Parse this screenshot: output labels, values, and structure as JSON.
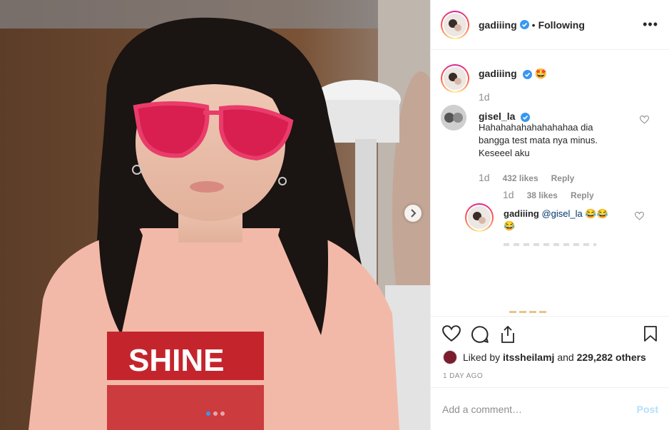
{
  "post": {
    "author": "gadiiing",
    "follow_sep": "•",
    "follow_status": "Following",
    "more_label": "•••",
    "caption_emoji": "🤩",
    "caption_time": "1d"
  },
  "comments": [
    {
      "user": "gisel_la",
      "text": "Hahahahahahahahahaa dia bangga test mata nya minus. Keseeel aku",
      "time": "1d",
      "likes": "432 likes",
      "reply_label": "Reply"
    }
  ],
  "reply_meta": {
    "time": "1d",
    "likes": "38 likes",
    "reply_label": "Reply"
  },
  "reply": {
    "user": "gadiiing",
    "mention": "@gisel_la",
    "emoji_inline": "😂😂",
    "emoji_tail": "😂"
  },
  "likes": {
    "prefix": "Liked by",
    "user": "itssheilamj",
    "middle": "and",
    "count": "229,282 others"
  },
  "post_time": "1 DAY AGO",
  "comment_box": {
    "placeholder": "Add a comment…",
    "post_label": "Post"
  },
  "carousel": {
    "total": 3,
    "active": 1
  },
  "colors": {
    "verified": "#3897f0",
    "mention": "#003569",
    "post_disabled": "#b2dffc",
    "muted": "#8e8e8e"
  }
}
